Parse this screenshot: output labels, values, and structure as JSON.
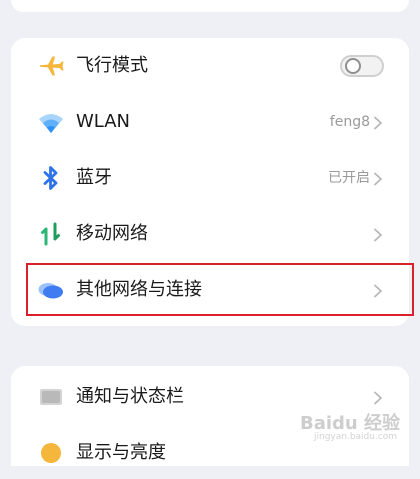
{
  "settings": {
    "items": [
      {
        "label": "飞行模式",
        "icon": "airplane-icon",
        "control": "toggle",
        "toggle_on": false
      },
      {
        "label": "WLAN",
        "icon": "wifi-icon",
        "value": "feng8"
      },
      {
        "label": "蓝牙",
        "icon": "bluetooth-icon",
        "value": "已开启"
      },
      {
        "label": "移动网络",
        "icon": "mobile-network-icon"
      },
      {
        "label": "其他网络与连接",
        "icon": "cloud-icon",
        "highlighted": true
      }
    ],
    "section2": [
      {
        "label": "通知与状态栏",
        "icon": "notification-icon"
      },
      {
        "label": "显示与亮度",
        "icon": "display-brightness-icon"
      }
    ]
  },
  "watermark": {
    "text": "Baidu 经验",
    "sub": "jingyan.baidu.com"
  },
  "colors": {
    "background": "#eef0f5",
    "card": "#ffffff",
    "airplane": "#f5b63c",
    "wifi": "#2f8ff5",
    "bluetooth": "#2f73e8",
    "mobile_up": "#2bb673",
    "mobile_down": "#1e9e5e",
    "cloud": "#3f7cf2",
    "highlight_border": "#d9202b"
  }
}
